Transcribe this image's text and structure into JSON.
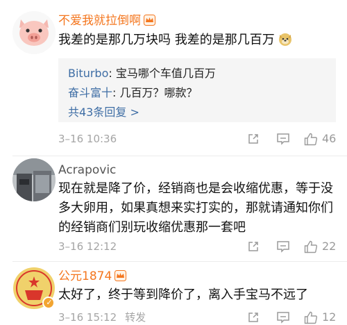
{
  "comments": [
    {
      "username": "不爱我就拉倒啊",
      "text": "我差的是那几万块吗 我差的是那几百万",
      "replies": [
        {
          "author": "Biturbo",
          "text": "宝马哪个车值几百万"
        },
        {
          "author": "奋斗富十",
          "text": "几百万？哪款？"
        }
      ],
      "more_replies": "共43条回复 >",
      "time": "3–16 10:36",
      "likes": "46"
    },
    {
      "username": "Acrapovic",
      "text": "现在就是降了价，经销商也是会收缩优惠，等于没多大卵用，如果真想来实打实的，那就请通知你们的经销商们别玩收缩优惠那一套吧",
      "time": "3–16 12:12",
      "likes": "22"
    },
    {
      "username": "公元1874",
      "text": "太好了，终于等到降价了，离入手宝马不远了",
      "time": "3–16 15:12",
      "forward": "转发",
      "likes": "12"
    }
  ],
  "colors": {
    "username_orange": "#f4761e",
    "reply_author_blue": "#3f6ea5",
    "meta_gray": "#a5a5a5",
    "reply_bg": "#f5f5f5"
  },
  "icons": [
    "crown-badge-icon",
    "doge-emoji-icon",
    "share-icon",
    "comment-icon",
    "like-icon",
    "verified-badge-icon"
  ]
}
